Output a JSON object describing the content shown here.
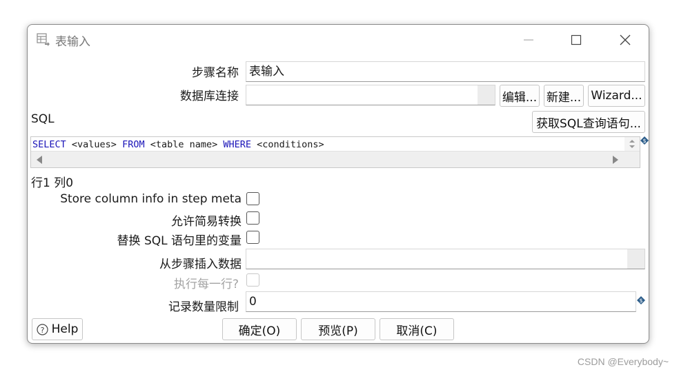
{
  "window": {
    "title": "表输入"
  },
  "form": {
    "step_name_label": "步骤名称",
    "step_name_value": "表输入",
    "db_conn_label": "数据库连接",
    "db_conn_value": "",
    "edit_button": "编辑...",
    "new_button": "新建...",
    "wizard_button": "Wizard...",
    "sql_label": "SQL",
    "get_sql_button": "获取SQL查询语句...",
    "sql": {
      "kw_select": "SELECT",
      "values": " <values> ",
      "kw_from": "FROM",
      "table": " <table name> ",
      "kw_where": "WHERE",
      "conditions": " <conditions>"
    },
    "position": "行1 列0",
    "store_column_label": "Store column info in step meta",
    "lazy_conversion_label": "允许简易转换",
    "replace_vars_label": "替换 SQL 语句里的变量",
    "insert_from_step_label": "从步骤插入数据",
    "insert_from_step_value": "",
    "execute_each_row_label": "执行每一行?",
    "limit_label": "记录数量限制",
    "limit_value": "0"
  },
  "buttons": {
    "help": "Help",
    "ok": "确定(O)",
    "preview": "预览(P)",
    "cancel": "取消(C)"
  },
  "watermark": "CSDN @Everybody~"
}
